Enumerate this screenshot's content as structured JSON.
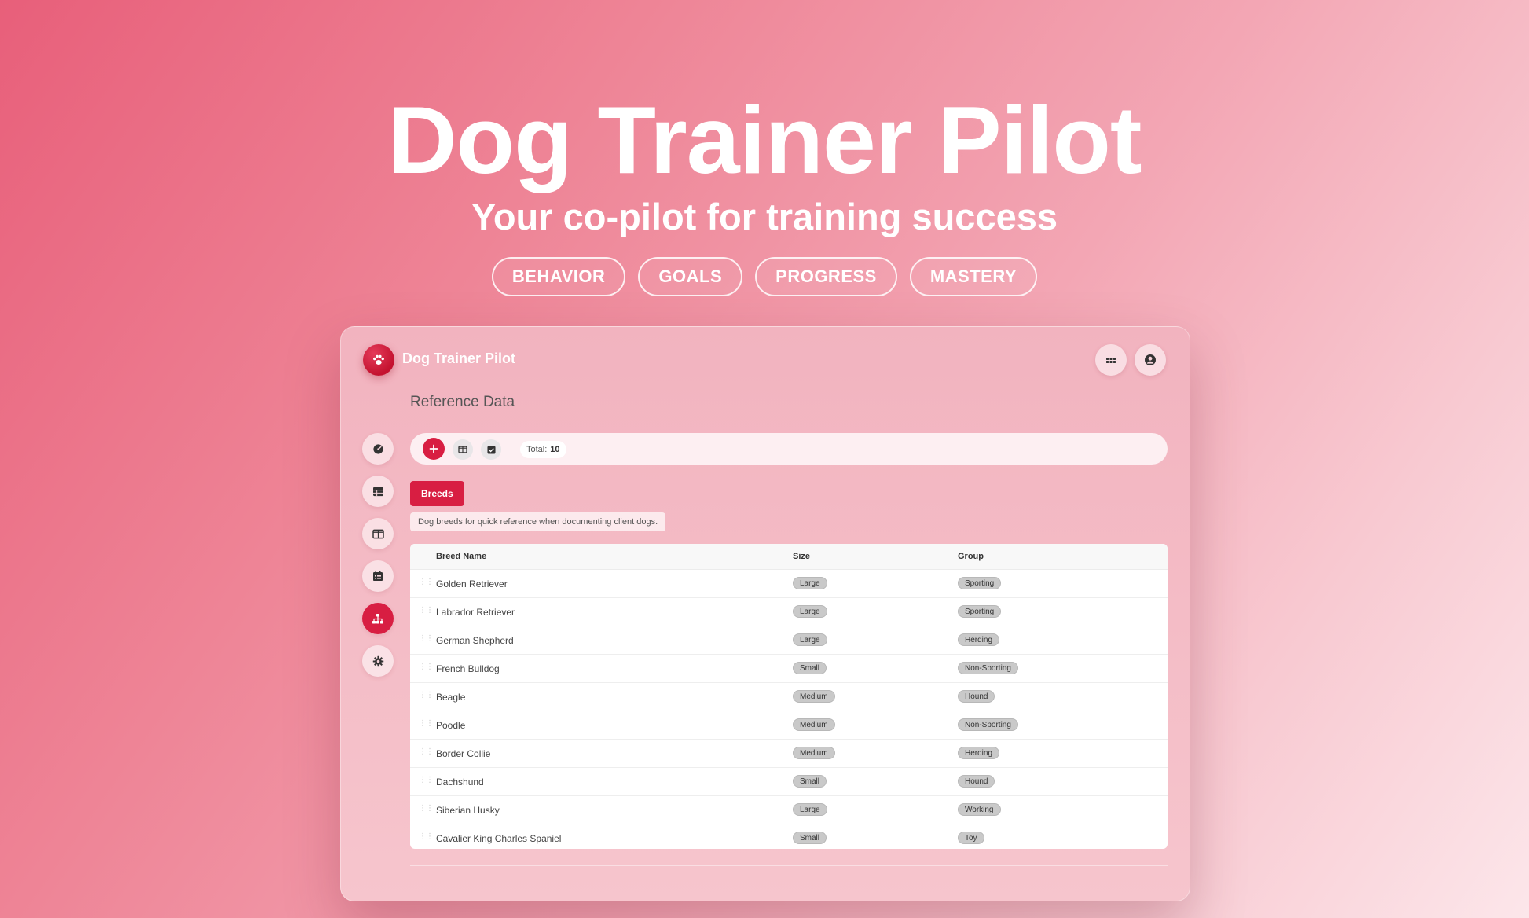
{
  "hero": {
    "title": "Dog Trainer Pilot",
    "subtitle": "Your co-pilot for training success",
    "pills": [
      "BEHAVIOR",
      "GOALS",
      "PROGRESS",
      "MASTERY"
    ]
  },
  "app": {
    "title": "Dog Trainer Pilot",
    "logo_icon": "paw-icon",
    "header_actions": [
      "apps-grid-icon",
      "user-account-icon"
    ],
    "section_title": "Reference Data",
    "sidebar": [
      {
        "icon": "dashboard-gauge-icon",
        "active": false
      },
      {
        "icon": "table-icon",
        "active": false
      },
      {
        "icon": "columns-icon",
        "active": false
      },
      {
        "icon": "calendar-icon",
        "active": false
      },
      {
        "icon": "hierarchy-icon",
        "active": true
      },
      {
        "icon": "gear-icon",
        "active": false
      }
    ],
    "toolbar": {
      "buttons": [
        "add-icon",
        "columns-icon",
        "checkbox-icon"
      ],
      "total_label": "Total:",
      "total_value": "10"
    },
    "tab_label": "Breeds",
    "description": "Dog breeds for quick reference when documenting client dogs.",
    "table": {
      "columns": [
        "Breed Name",
        "Size",
        "Group"
      ],
      "rows": [
        {
          "name": "Golden Retriever",
          "size": "Large",
          "group": "Sporting"
        },
        {
          "name": "Labrador Retriever",
          "size": "Large",
          "group": "Sporting"
        },
        {
          "name": "German Shepherd",
          "size": "Large",
          "group": "Herding"
        },
        {
          "name": "French Bulldog",
          "size": "Small",
          "group": "Non-Sporting"
        },
        {
          "name": "Beagle",
          "size": "Medium",
          "group": "Hound"
        },
        {
          "name": "Poodle",
          "size": "Medium",
          "group": "Non-Sporting"
        },
        {
          "name": "Border Collie",
          "size": "Medium",
          "group": "Herding"
        },
        {
          "name": "Dachshund",
          "size": "Small",
          "group": "Hound"
        },
        {
          "name": "Siberian Husky",
          "size": "Large",
          "group": "Working"
        },
        {
          "name": "Cavalier King Charles Spaniel",
          "size": "Small",
          "group": "Toy"
        }
      ]
    }
  },
  "colors": {
    "accent": "#d81e42",
    "background_start": "#e85f7a",
    "background_end": "#fce6ea",
    "badge_bg": "#c9c9c9"
  }
}
